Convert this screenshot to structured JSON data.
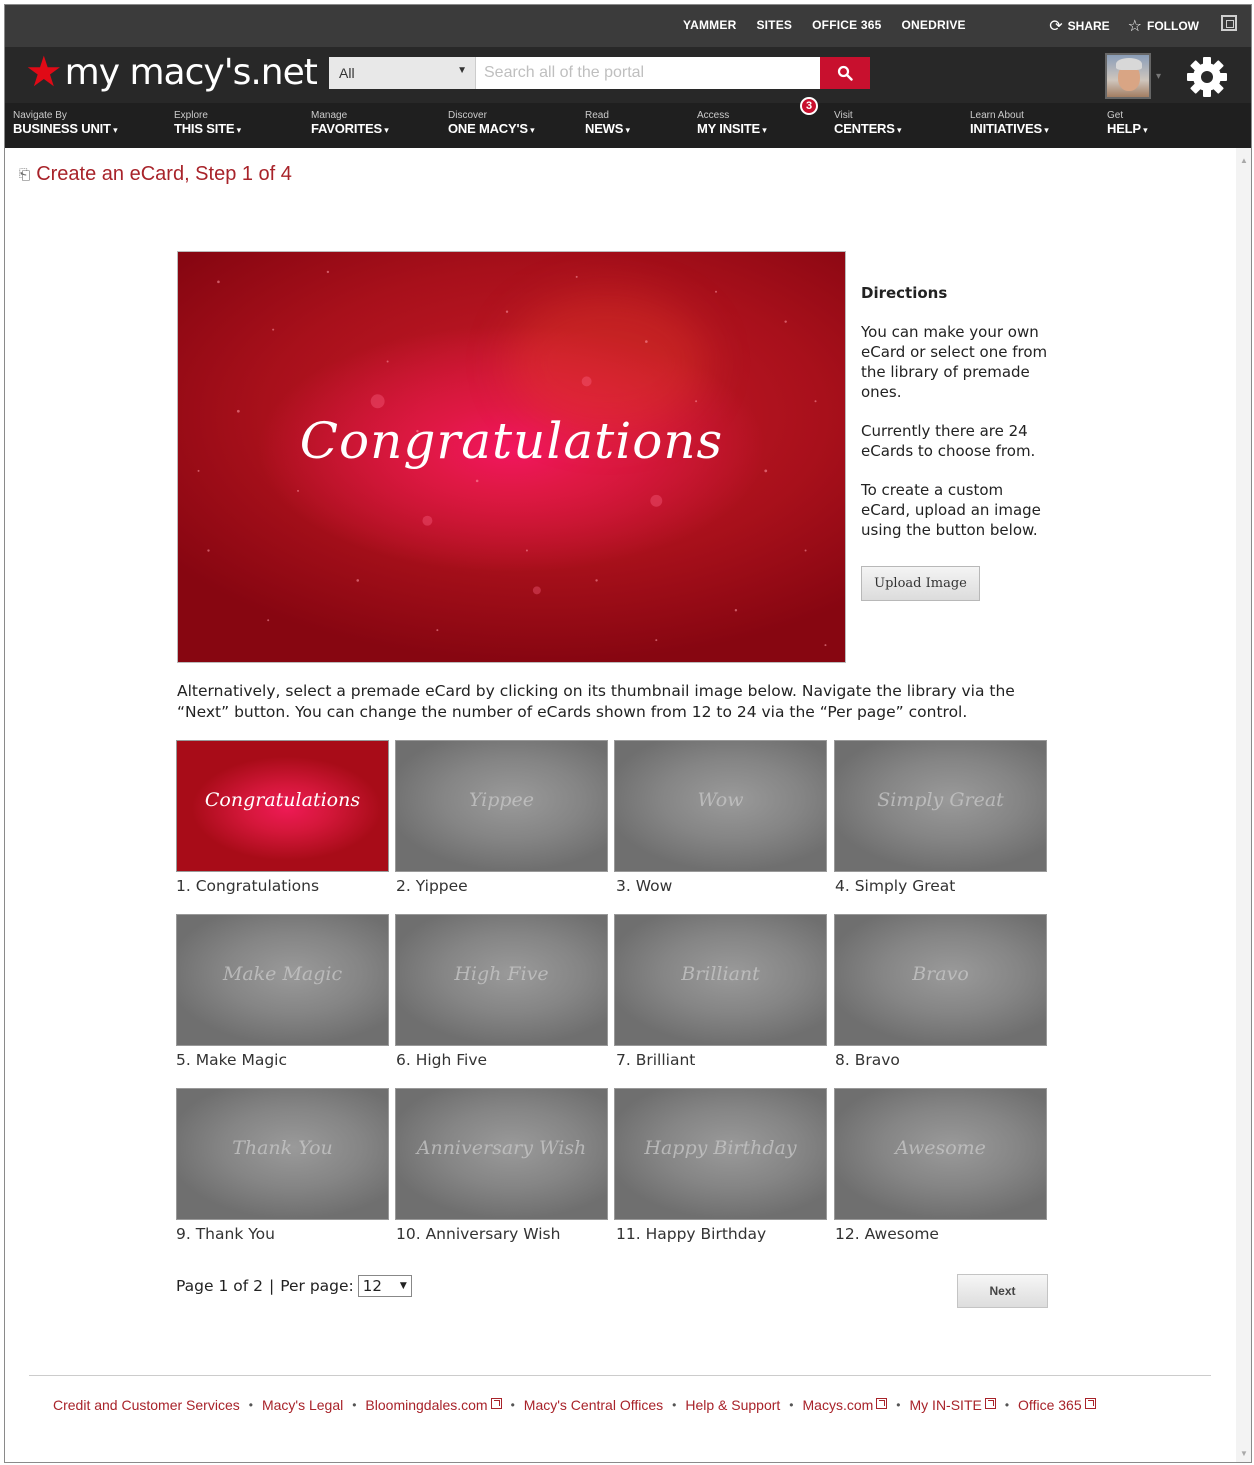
{
  "suitebar": {
    "links": [
      "YAMMER",
      "SITES",
      "OFFICE 365",
      "ONEDRIVE"
    ],
    "share_label": "SHARE",
    "follow_label": "FOLLOW"
  },
  "brand": {
    "logo_text": "my macy's.net",
    "accent_color": "#c8102e"
  },
  "search": {
    "scope": "All",
    "placeholder": "Search all of the portal"
  },
  "nav": [
    {
      "small": "Navigate By",
      "big": "BUSINESS UNIT"
    },
    {
      "small": "Explore",
      "big": "THIS SITE"
    },
    {
      "small": "Manage",
      "big": "FAVORITES"
    },
    {
      "small": "Discover",
      "big": "ONE MACY'S"
    },
    {
      "small": "Read",
      "big": "NEWS"
    },
    {
      "small": "Access",
      "big": "MY INSITE"
    },
    {
      "small": "Visit",
      "big": "CENTERS"
    },
    {
      "small": "Learn About",
      "big": "INITIATIVES"
    },
    {
      "small": "Get",
      "big": "HELP"
    }
  ],
  "notification_count": "3",
  "page_title": "Create an eCard, Step 1 of 4",
  "hero": {
    "script_text": "Congratulations"
  },
  "directions": {
    "heading": "Directions",
    "p1": "You can make your own eCard or select one from the library of premade ones.",
    "p2": "Currently there are 24 eCards to choose from.",
    "p3": "To create a custom eCard, upload an image using the button below.",
    "upload_label": "Upload Image"
  },
  "intro_text": "Alternatively, select a premade eCard by clicking on its thumbnail image below. Navigate the library via the “Next” button. You can change the number of eCards shown from 12 to 24 via the “Per page” control.",
  "cards": [
    {
      "script": "Congratulations",
      "caption": "1. Congratulations"
    },
    {
      "script": "Yippee",
      "caption": "2. Yippee"
    },
    {
      "script": "Wow",
      "caption": "3. Wow"
    },
    {
      "script": "Simply Great",
      "caption": "4. Simply Great"
    },
    {
      "script": "Make Magic",
      "caption": "5. Make Magic"
    },
    {
      "script": "High Five",
      "caption": "6. High Five"
    },
    {
      "script": "Brilliant",
      "caption": "7. Brilliant"
    },
    {
      "script": "Bravo",
      "caption": "8. Bravo"
    },
    {
      "script": "Thank You",
      "caption": "9. Thank You"
    },
    {
      "script": "Anniversary Wish",
      "caption": "10. Anniversary Wish"
    },
    {
      "script": "Happy Birthday",
      "caption": "11. Happy Birthday"
    },
    {
      "script": "Awesome",
      "caption": "12. Awesome"
    }
  ],
  "pager": {
    "page_text": "Page 1 of 2",
    "separator": "|",
    "per_page_label": "Per page:",
    "per_page_value": "12",
    "next_label": "Next"
  },
  "footer": [
    {
      "label": "Credit and Customer Services",
      "external": false
    },
    {
      "label": "Macy's Legal",
      "external": false
    },
    {
      "label": "Bloomingdales.com",
      "external": true
    },
    {
      "label": "Macy's Central Offices",
      "external": false
    },
    {
      "label": "Help & Support",
      "external": false
    },
    {
      "label": "Macys.com",
      "external": true
    },
    {
      "label": "My IN-SITE",
      "external": true
    },
    {
      "label": "Office 365",
      "external": true
    }
  ]
}
